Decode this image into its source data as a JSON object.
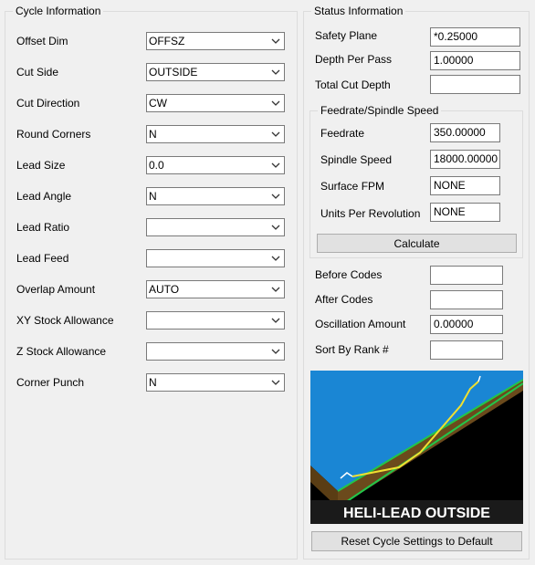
{
  "cycle": {
    "title": "Cycle Information",
    "fields": [
      {
        "label": "Offset Dim",
        "value": "OFFSZ"
      },
      {
        "label": "Cut Side",
        "value": "OUTSIDE"
      },
      {
        "label": "Cut Direction",
        "value": "CW"
      },
      {
        "label": "Round Corners",
        "value": "N"
      },
      {
        "label": "Lead Size",
        "value": "0.0"
      },
      {
        "label": "Lead Angle",
        "value": "N"
      },
      {
        "label": "Lead Ratio",
        "value": ""
      },
      {
        "label": "Lead Feed",
        "value": ""
      },
      {
        "label": "Overlap Amount",
        "value": "AUTO"
      },
      {
        "label": "XY Stock Allowance",
        "value": ""
      },
      {
        "label": "Z Stock Allowance",
        "value": ""
      },
      {
        "label": "Corner Punch",
        "value": "N"
      }
    ]
  },
  "status": {
    "title": "Status Information",
    "safety_plane": {
      "label": "Safety Plane",
      "value": "*0.25000"
    },
    "depth_per_pass": {
      "label": "Depth Per Pass",
      "value": "1.00000"
    },
    "total_cut_depth": {
      "label": "Total Cut Depth",
      "value": ""
    },
    "feed": {
      "title": "Feedrate/Spindle Speed",
      "feedrate": {
        "label": "Feedrate",
        "value": "350.00000"
      },
      "spindle_speed": {
        "label": "Spindle Speed",
        "value": "18000.00000"
      },
      "surface_fpm": {
        "label": "Surface FPM",
        "value": "NONE"
      },
      "units_per_rev": {
        "label": "Units Per Revolution",
        "value": "NONE"
      },
      "calculate_label": "Calculate"
    },
    "before_codes": {
      "label": "Before Codes",
      "value": ""
    },
    "after_codes": {
      "label": "After Codes",
      "value": ""
    },
    "oscillation": {
      "label": "Oscillation Amount",
      "value": "0.00000"
    },
    "sort_by_rank": {
      "label": "Sort By Rank #",
      "value": ""
    },
    "preview_caption": "HELI-LEAD OUTSIDE",
    "reset_label": "Reset Cycle Settings to Default"
  },
  "colors": {
    "preview_bg": "#000000",
    "sky": "#1a86d4",
    "material": "#6b4a1c",
    "path": "#f0e030",
    "edge": "#22c64a"
  }
}
